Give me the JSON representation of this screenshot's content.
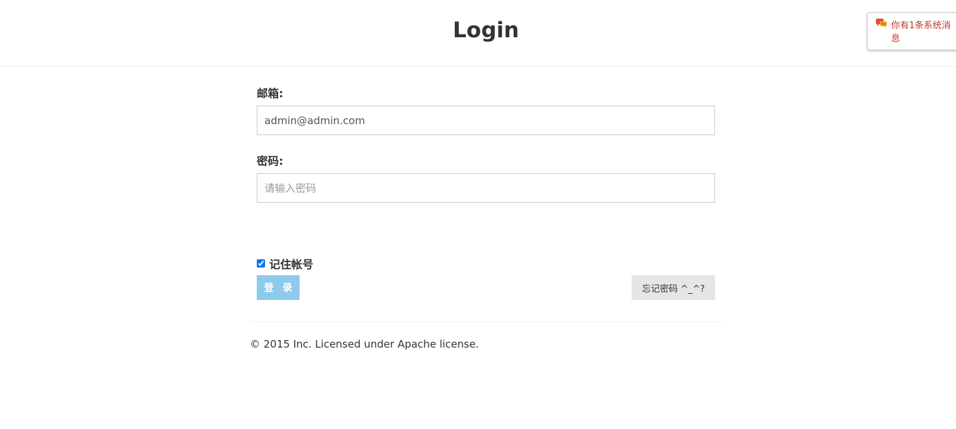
{
  "header": {
    "title": "Login"
  },
  "notice": {
    "text": "你有1条系统消息",
    "icon": "chat-bubbles-icon",
    "color": "#c0392b"
  },
  "form": {
    "email": {
      "label": "邮箱:",
      "value": "admin@admin.com",
      "placeholder": ""
    },
    "password": {
      "label": "密码:",
      "value": "",
      "placeholder": "请输入密码"
    },
    "remember": {
      "label": "记住帐号",
      "checked": true
    },
    "login_label": "登 录",
    "login_color": "#8ecbeb",
    "forgot_label": "忘记密码 ^_^?"
  },
  "footer": {
    "text": "© 2015 Inc. Licensed under Apache license."
  }
}
